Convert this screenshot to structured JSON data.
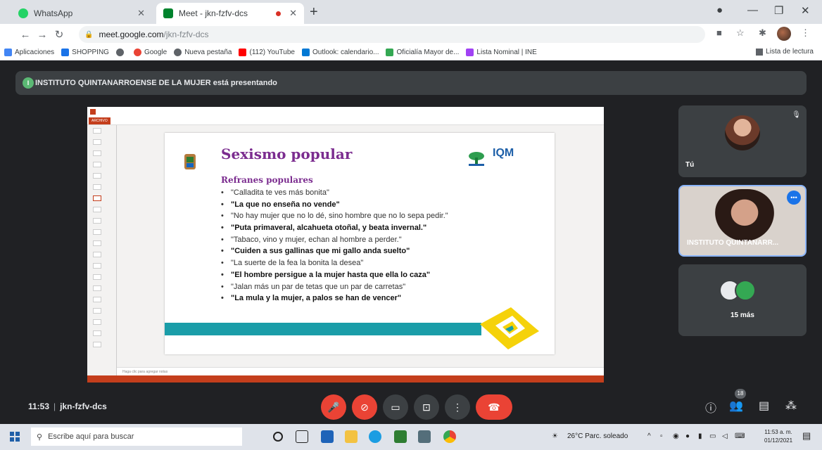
{
  "browser": {
    "tabs": [
      {
        "title": "WhatsApp",
        "favicon_color": "#25d366"
      },
      {
        "title": "Meet - jkn-fzfv-dcs",
        "favicon_color": "#00832d"
      }
    ],
    "new_tab": "+",
    "url_host": "meet.google.com",
    "url_path": "/jkn-fzfv-dcs",
    "bookmarks": [
      {
        "label": "Aplicaciones",
        "color": "#4285f4"
      },
      {
        "label": "SHOPPING",
        "color": "#1a73e8"
      },
      {
        "label": "",
        "color": "#5f6368"
      },
      {
        "label": "Google",
        "color": "#ea4335"
      },
      {
        "label": "Nueva pestaña",
        "color": "#5f6368"
      },
      {
        "label": "(112) YouTube",
        "color": "#ff0000"
      },
      {
        "label": "Outlook: calendario...",
        "color": "#0078d4"
      },
      {
        "label": "Oficialía Mayor de...",
        "color": "#34a853"
      },
      {
        "label": "Lista Nominal | INE",
        "color": "#a142f4"
      }
    ],
    "reading_list": "Lista de lectura"
  },
  "meet": {
    "banner": "INSTITUTO QUINTANARROENSE DE LA MUJER está presentando",
    "meeting_time": "11:53",
    "meeting_code": "jkn-fzfv-dcs",
    "participants": [
      {
        "name": "Tú"
      },
      {
        "name": "INSTITUTO QUINTANARR..."
      },
      {
        "name": "15 más"
      }
    ],
    "people_count": "18",
    "accent": "#8ab4f8",
    "danger": "#ea4335"
  },
  "slide": {
    "title": "Sexismo popular",
    "subtitle": "Refranes populares",
    "logo_right": "IQM",
    "items": [
      {
        "text": "\"Calladita te ves más bonita\"",
        "bold": false
      },
      {
        "text": "\"La que no enseña no vende\"",
        "bold": true
      },
      {
        "text": "\"No hay mujer que no lo dé, sino hombre que no lo sepa pedir.\"",
        "bold": false
      },
      {
        "text": "\"Puta primaveral, alcahueta otoñal, y beata invernal.\"",
        "bold": true
      },
      {
        "text": "\"Tabaco, vino y mujer, echan al hombre a perder.\"",
        "bold": false
      },
      {
        "text": "\"Cuiden a sus gallinas que mi gallo anda suelto\"",
        "bold": true
      },
      {
        "text": "\"La suerte de la fea la bonita la desea\"",
        "bold": false
      },
      {
        "text": "\"El hombre persigue a la mujer hasta que ella lo caza\"",
        "bold": true
      },
      {
        "text": "\"Jalan más un par de tetas que un par de carretas\"",
        "bold": false
      },
      {
        "text": "\"La mula y la mujer, a palos se han de vencer\"",
        "bold": true
      }
    ]
  },
  "ppt": {
    "file_tab": "ARCHIVO",
    "notes_placeholder": "Haga clic para agregar notas"
  },
  "taskbar": {
    "search_placeholder": "Escribe aquí para buscar",
    "weather": "26°C  Parc. soleado",
    "time": "11:53 a. m.",
    "date": "01/12/2021"
  }
}
